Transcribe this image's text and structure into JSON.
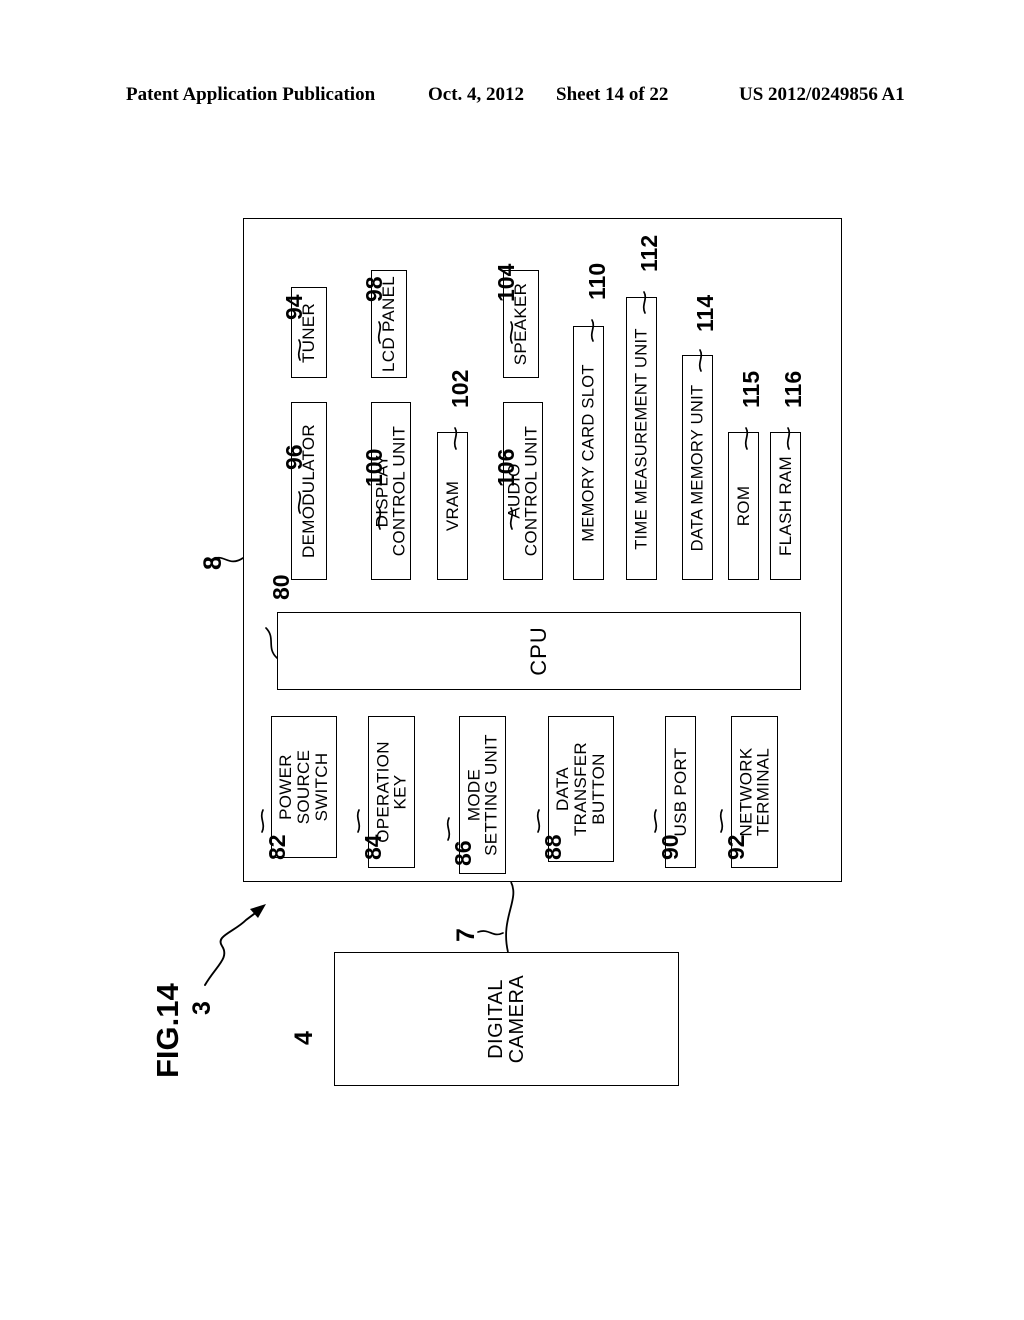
{
  "header": {
    "publication": "Patent Application Publication",
    "date": "Oct. 4, 2012",
    "sheet": "Sheet 14 of 22",
    "number": "US 2012/0249856 A1"
  },
  "figure": {
    "label": "FIG.14",
    "system_ref": "3",
    "device_ref": "8",
    "link_ref": "7",
    "camera_ref": "4"
  },
  "cpu": {
    "label": "CPU",
    "ref": "80"
  },
  "digital_camera": {
    "line1": "DIGITAL",
    "line2": "CAMERA"
  },
  "top_blocks": [
    {
      "id": "tuner",
      "label_lines": [
        "TUNER"
      ],
      "ref": "94"
    },
    {
      "id": "demodulator",
      "label_lines": [
        "DEMODULATOR"
      ],
      "ref": "96"
    },
    {
      "id": "lcd-panel",
      "label_lines": [
        "LCD PANEL"
      ],
      "ref": "98"
    },
    {
      "id": "display-control",
      "label_lines": [
        "DISPLAY",
        "CONTROL UNIT"
      ],
      "ref": "100"
    },
    {
      "id": "vram",
      "label_lines": [
        "VRAM"
      ],
      "ref": "102"
    },
    {
      "id": "speaker",
      "label_lines": [
        "SPEAKER"
      ],
      "ref": "104"
    },
    {
      "id": "audio-control",
      "label_lines": [
        "AUDIO",
        "CONTROL UNIT"
      ],
      "ref": "106"
    },
    {
      "id": "memory-card-slot",
      "label_lines": [
        "MEMORY CARD SLOT"
      ],
      "ref": "110"
    },
    {
      "id": "time-measurement",
      "label_lines": [
        "TIME MEASUREMENT UNIT"
      ],
      "ref": "112"
    },
    {
      "id": "data-memory",
      "label_lines": [
        "DATA MEMORY UNIT"
      ],
      "ref": "114"
    },
    {
      "id": "rom",
      "label_lines": [
        "ROM"
      ],
      "ref": "115"
    },
    {
      "id": "flash-ram",
      "label_lines": [
        "FLASH RAM"
      ],
      "ref": "116"
    }
  ],
  "bottom_blocks": [
    {
      "id": "power-source-switch",
      "label_lines": [
        "POWER",
        "SOURCE",
        "SWITCH"
      ],
      "ref": "82"
    },
    {
      "id": "operation-key",
      "label_lines": [
        "OPERATION",
        "KEY"
      ],
      "ref": "84"
    },
    {
      "id": "mode-setting-unit",
      "label_lines": [
        "MODE",
        "SETTING UNIT"
      ],
      "ref": "86"
    },
    {
      "id": "data-transfer-button",
      "label_lines": [
        "DATA",
        "TRANSFER",
        "BUTTON"
      ],
      "ref": "88"
    },
    {
      "id": "usb-port",
      "label_lines": [
        "USB PORT"
      ],
      "ref": "90"
    },
    {
      "id": "network-terminal",
      "label_lines": [
        "NETWORK",
        "TERMINAL"
      ],
      "ref": "92"
    }
  ]
}
